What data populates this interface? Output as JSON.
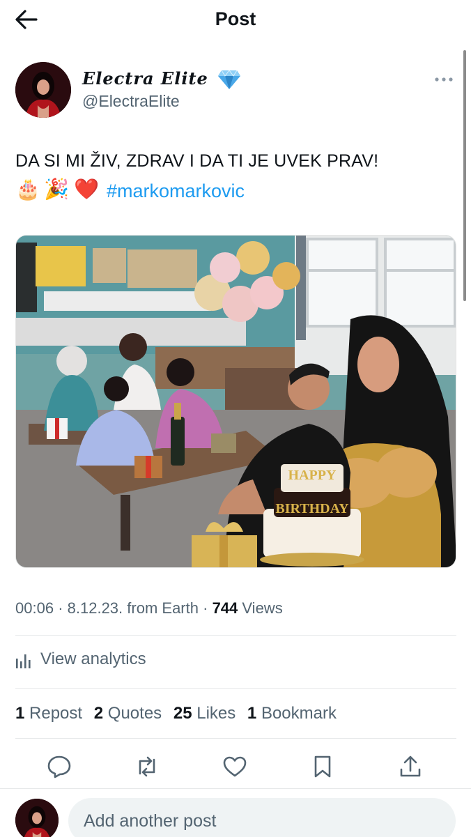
{
  "header": {
    "title": "Post"
  },
  "author": {
    "name": "Electra Elite",
    "handle": "@ElectraElite"
  },
  "post": {
    "text": "DA SI MI ŽIV, ZDRAV I DA TI JE UVEK PRAV!",
    "emojis": [
      "🎂",
      "🎉",
      "❤️"
    ],
    "hashtag": "#markomarkovic"
  },
  "meta": {
    "time": "00:06",
    "date": "8.12.23.",
    "location": "from Earth",
    "views_count": "744",
    "views_label": "Views",
    "separator": "·"
  },
  "analytics": {
    "label": "View analytics"
  },
  "stats": [
    {
      "count": "1",
      "label": "Repost"
    },
    {
      "count": "2",
      "label": "Quotes"
    },
    {
      "count": "25",
      "label": "Likes"
    },
    {
      "count": "1",
      "label": "Bookmark"
    }
  ],
  "image_text": {
    "cake_top": "HAPPY",
    "cake_bottom": "BIRTHDAY"
  },
  "actions": [
    "reply-icon",
    "repost-icon",
    "like-icon",
    "bookmark-icon",
    "share-icon"
  ],
  "reply": {
    "placeholder": "Add another post"
  },
  "colors": {
    "link": "#1d9bf0",
    "secondary_text": "#536471",
    "verified": "#4aa8e8"
  }
}
